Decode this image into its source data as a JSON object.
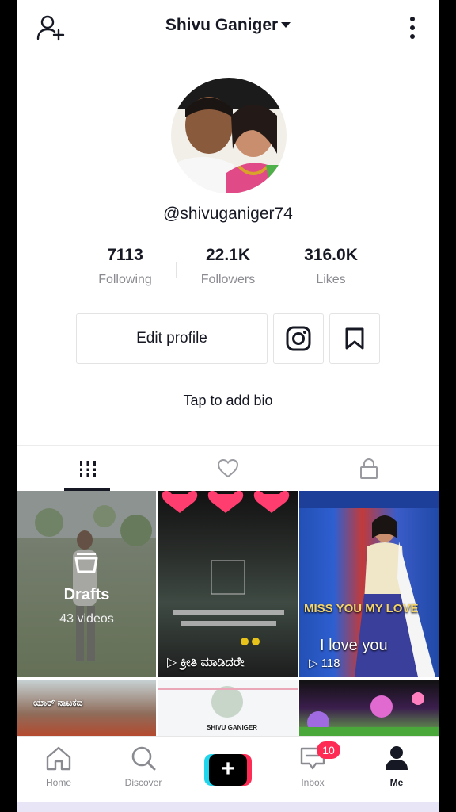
{
  "header": {
    "title": "Shivu Ganiger",
    "add_user_icon": "add-user-icon",
    "menu_icon": "more-vertical-icon"
  },
  "profile": {
    "username": "@shivuganiger74",
    "bio_prompt": "Tap to add bio"
  },
  "stats": [
    {
      "value": "7113",
      "label": "Following"
    },
    {
      "value": "22.1K",
      "label": "Followers"
    },
    {
      "value": "316.0K",
      "label": "Likes"
    }
  ],
  "actions": {
    "edit_profile": "Edit profile",
    "instagram_icon": "instagram-icon",
    "bookmark_icon": "bookmark-icon"
  },
  "tabs": [
    {
      "icon": "grid-icon",
      "active": true
    },
    {
      "icon": "heart-icon",
      "active": false
    },
    {
      "icon": "lock-icon",
      "active": false
    }
  ],
  "grid": {
    "drafts": {
      "label": "Drafts",
      "count": "43 videos"
    },
    "items": [
      {
        "caption": "▷ ಕ್ರೀತಿ ಮಾಡಿದರೇ"
      },
      {
        "caption_top": "MISS YOU MY LOVE",
        "caption_bottom": "I love you",
        "views": "▷ 118"
      },
      {
        "caption": "ಯಾರ್ ನಾಟಕದ"
      },
      {
        "caption": "SHIVU GANIGER"
      },
      {
        "caption": ""
      }
    ]
  },
  "nav": [
    {
      "label": "Home",
      "icon": "home-icon"
    },
    {
      "label": "Discover",
      "icon": "search-icon"
    },
    {
      "label": "",
      "icon": "create-plus-icon"
    },
    {
      "label": "Inbox",
      "icon": "inbox-icon",
      "badge": "10"
    },
    {
      "label": "Me",
      "icon": "person-icon"
    }
  ],
  "colors": {
    "accent_red": "#fe2c55",
    "accent_cyan": "#20d5ec",
    "text": "#161823",
    "muted": "#8a8b91"
  }
}
